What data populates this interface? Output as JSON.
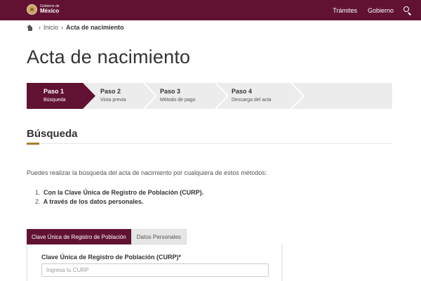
{
  "header": {
    "logo_small": "Gobierno de",
    "logo_big": "México",
    "nav": [
      "Trámites",
      "Gobierno"
    ],
    "brand_color": "#611232"
  },
  "breadcrumb": {
    "home_icon": "home-icon",
    "items": [
      "Inicio",
      "Acta de nacimiento"
    ]
  },
  "page": {
    "title": "Acta de nacimiento"
  },
  "stepper": {
    "active_index": 0,
    "steps": [
      {
        "title": "Paso 1",
        "subtitle": "Búsqueda"
      },
      {
        "title": "Paso 2",
        "subtitle": "Vista previa"
      },
      {
        "title": "Paso 3",
        "subtitle": "Método de pago"
      },
      {
        "title": "Paso 4",
        "subtitle": "Descarga del acta"
      }
    ]
  },
  "section": {
    "title": "Búsqueda",
    "accent_color": "#a57f2c",
    "intro": "Puedes realizar la búsqueda del acta de nacimiento por cualquiera de estos métodos:",
    "methods": [
      {
        "num": "1.",
        "text": "Con la Clave Única de Registro de Población (CURP)."
      },
      {
        "num": "2.",
        "text": "A través de los datos personales."
      }
    ]
  },
  "tabs": {
    "items": [
      "Clave Única de Registro de Población",
      "Datos Personales"
    ],
    "active_index": 0
  },
  "form": {
    "curp_label": "Clave Única de Registro de Población (CURP)*",
    "curp_placeholder": "Ingresa tu CURP",
    "curp_value": ""
  }
}
